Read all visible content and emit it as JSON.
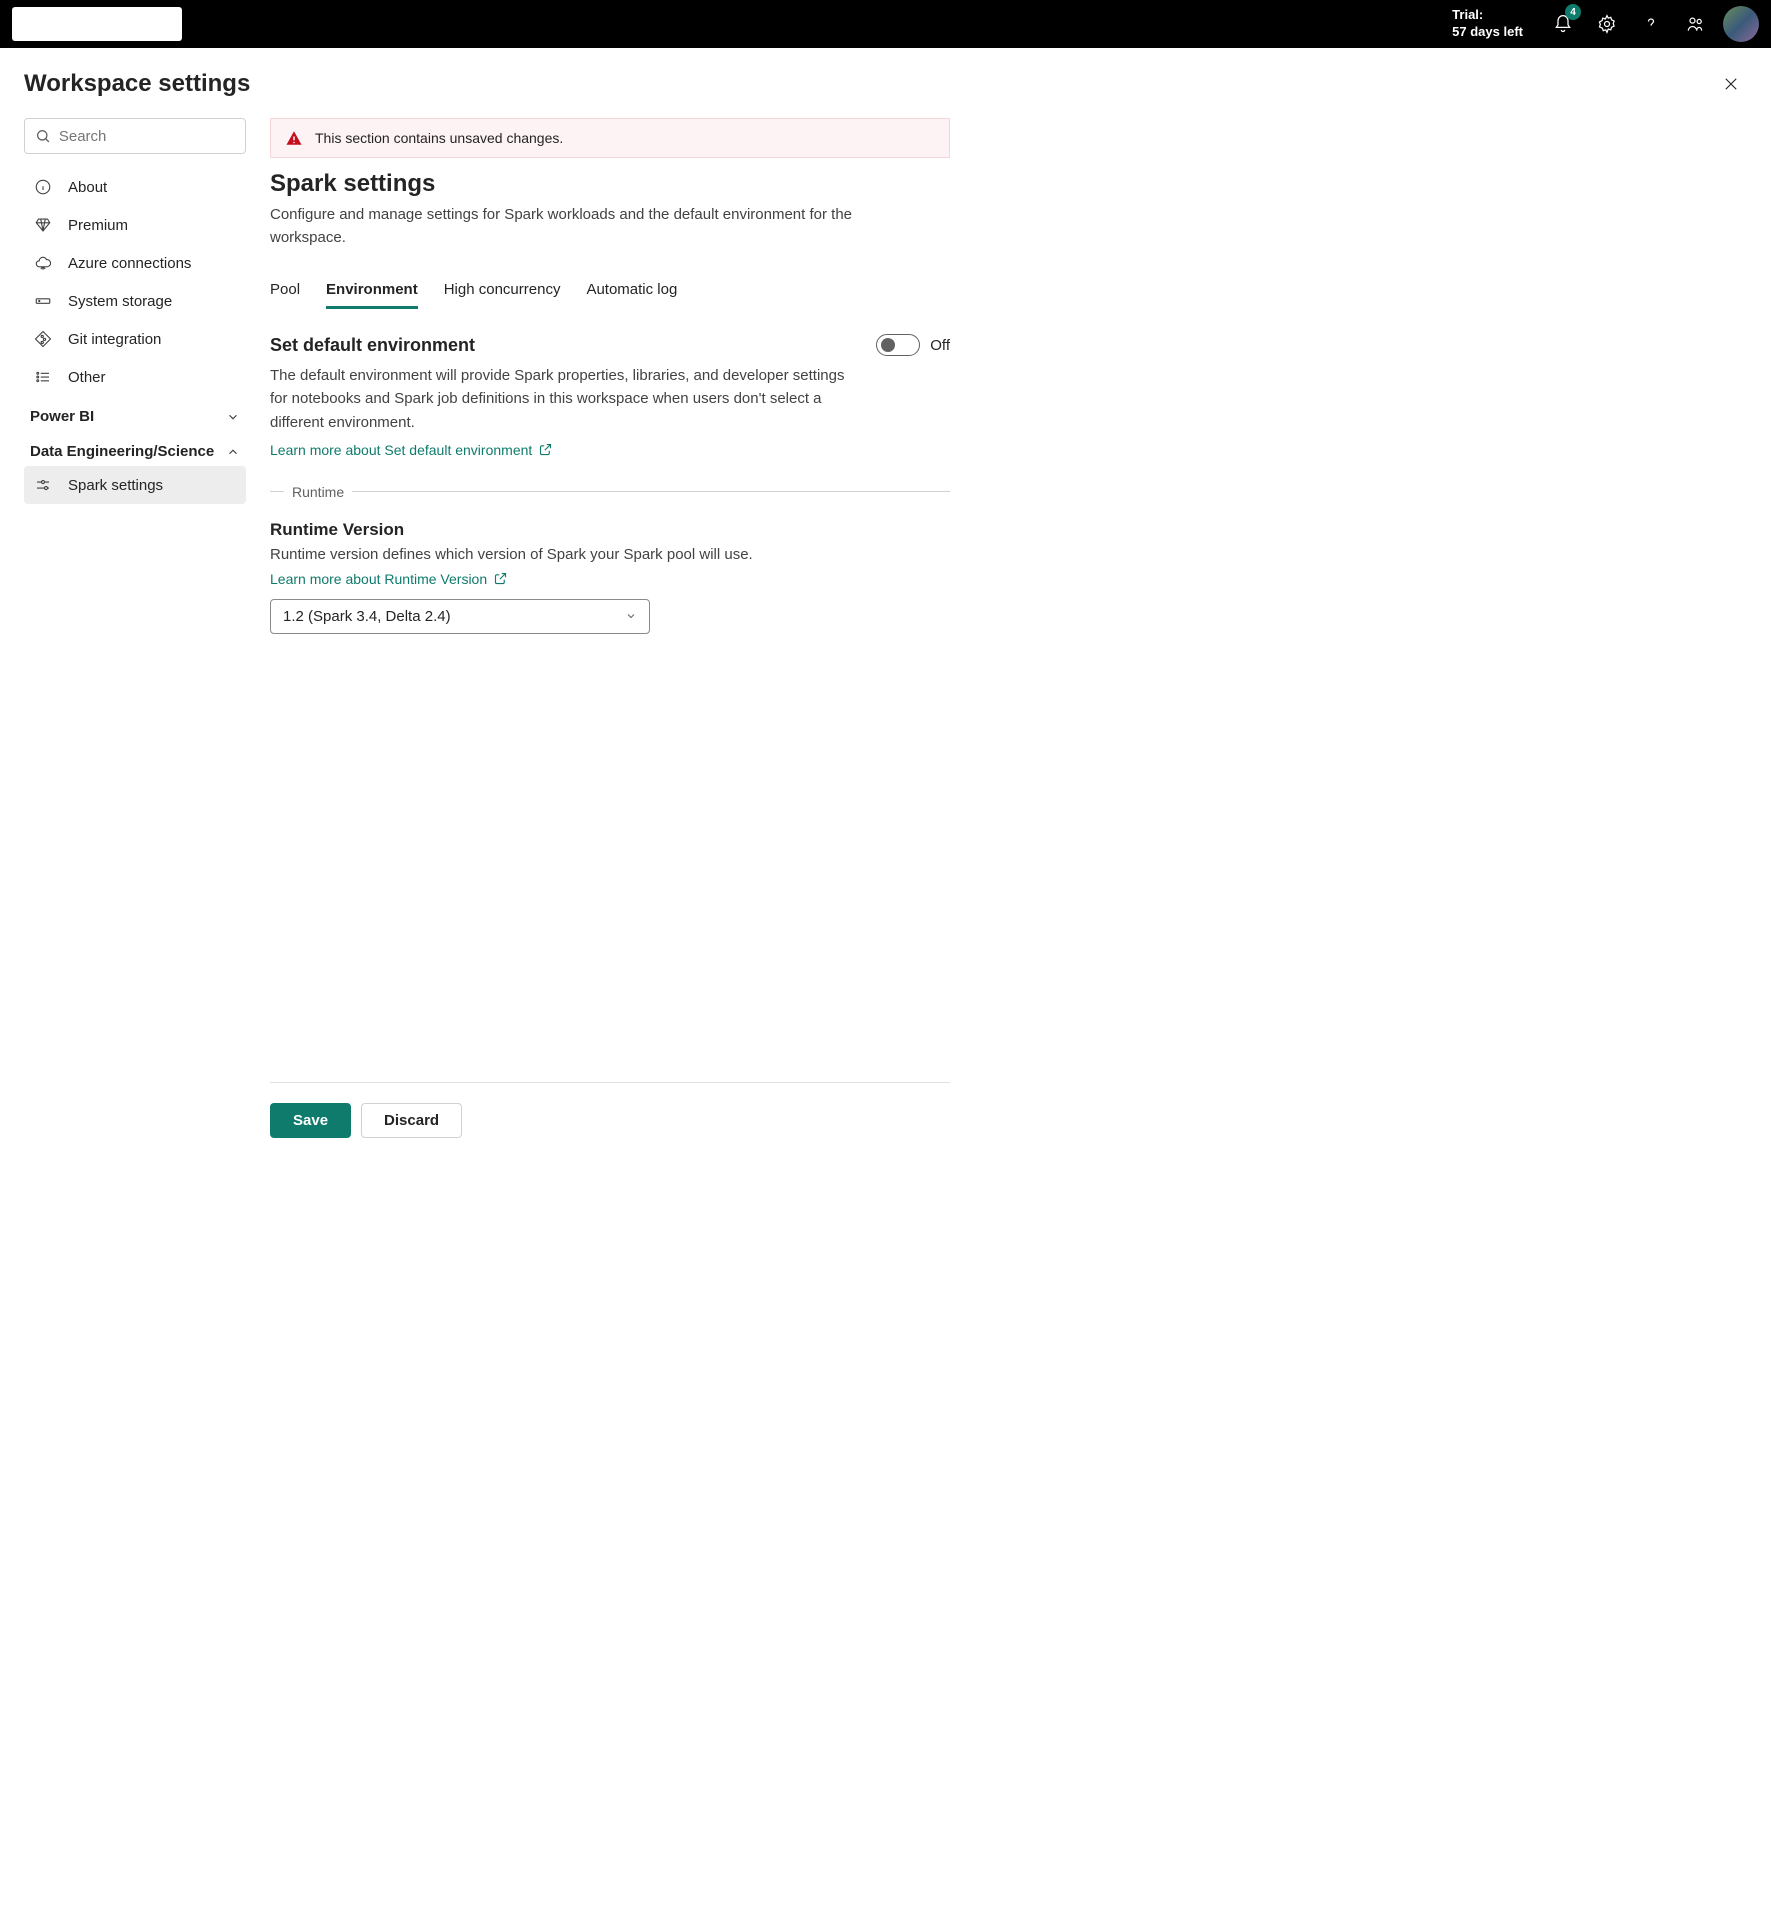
{
  "topbar": {
    "trial_line1": "Trial:",
    "trial_line2": "57 days left",
    "notification_count": "4"
  },
  "page": {
    "title": "Workspace settings"
  },
  "search": {
    "placeholder": "Search"
  },
  "nav": {
    "items": [
      {
        "label": "About"
      },
      {
        "label": "Premium"
      },
      {
        "label": "Azure connections"
      },
      {
        "label": "System storage"
      },
      {
        "label": "Git integration"
      },
      {
        "label": "Other"
      }
    ],
    "sections": {
      "powerbi": {
        "label": "Power BI"
      },
      "data_eng": {
        "label": "Data Engineering/Science"
      }
    },
    "subitems": {
      "spark": {
        "label": "Spark settings"
      }
    }
  },
  "banner": {
    "message": "This section contains unsaved changes."
  },
  "main": {
    "title": "Spark settings",
    "desc": "Configure and manage settings for Spark workloads and the default environment for the workspace."
  },
  "tabs": [
    {
      "label": "Pool"
    },
    {
      "label": "Environment"
    },
    {
      "label": "High concurrency"
    },
    {
      "label": "Automatic log"
    }
  ],
  "default_env": {
    "title": "Set default environment",
    "toggle_label": "Off",
    "desc": "The default environment will provide Spark properties, libraries, and developer settings for notebooks and Spark job definitions in this workspace when users don't select a different environment.",
    "link": "Learn more about Set default environment"
  },
  "runtime_section": {
    "legend": "Runtime",
    "title": "Runtime Version",
    "desc": "Runtime version defines which version of Spark your Spark pool will use.",
    "link": "Learn more about Runtime Version",
    "selected": "1.2 (Spark 3.4, Delta 2.4)"
  },
  "footer": {
    "save": "Save",
    "discard": "Discard"
  }
}
